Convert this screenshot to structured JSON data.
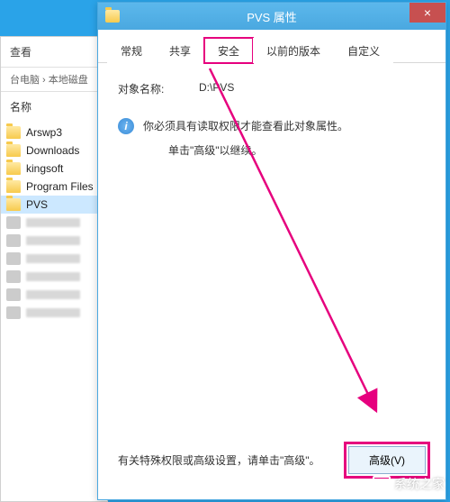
{
  "explorer": {
    "header": "查看",
    "path": "台电脑 › 本地磁盘",
    "section_label": "名称",
    "folders": [
      "Arswp3",
      "Downloads",
      "kingsoft",
      "Program Files",
      "PVS"
    ],
    "selected_index": 4
  },
  "dialog": {
    "title": "PVS 属性",
    "close": "×",
    "tabs": [
      "常规",
      "共享",
      "安全",
      "以前的版本",
      "自定义"
    ],
    "active_tab_index": 2,
    "highlighted_tab_index": 2,
    "object_label": "对象名称:",
    "object_value": "D:\\PVS",
    "info_text": "你必须具有读取权限才能查看此对象属性。",
    "continue_text": "单击\"高级\"以继续。",
    "hint_text": "有关特殊权限或高级设置，请单击\"高级\"。",
    "advanced_btn": "高级(V)"
  },
  "watermark": "系统之家",
  "colors": {
    "accent_pink": "#e6007e"
  }
}
